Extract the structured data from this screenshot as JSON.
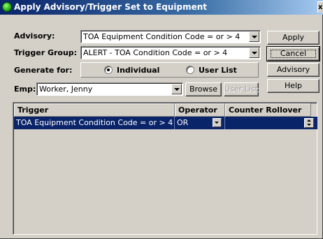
{
  "window": {
    "title": "Apply Advisory/Trigger Set to Equipment",
    "close_glyph": "x"
  },
  "form": {
    "advisory_label": "Advisory:",
    "advisory_value": "TOA Equipment Condition Code = or > 4",
    "trigger_group_label": "Trigger Group:",
    "trigger_group_value": "ALERT - TOA Condition Code = or > 4",
    "generate_for_label": "Generate for:",
    "radio_individual_label": "Individual",
    "radio_userlist_label": "User List",
    "generate_for_selected": "Individual",
    "emp_label": "Emp:",
    "emp_value": "Worker,  Jenny",
    "browse_label": "Browse",
    "user_list_label": "User List"
  },
  "buttons": {
    "apply": "Apply",
    "cancel": "Cancel",
    "advisory": "Advisory",
    "help": "Help"
  },
  "grid": {
    "columns": [
      "Trigger",
      "Operator",
      "Counter Rollover"
    ],
    "rows": [
      {
        "trigger": "TOA Equipment Condition Code = or > 4",
        "operator": "OR",
        "counter_rollover": ""
      }
    ],
    "selected_row": 0
  },
  "icons": {
    "app": "green-orb-icon",
    "close": "close-icon",
    "dropdown": "chevron-down-icon",
    "spinner": "spinner-icon"
  },
  "colors": {
    "title_bar_start": "#0a246a",
    "title_bar_end": "#a6caf0",
    "selection": "#0a246a",
    "face": "#d4d0c8"
  }
}
